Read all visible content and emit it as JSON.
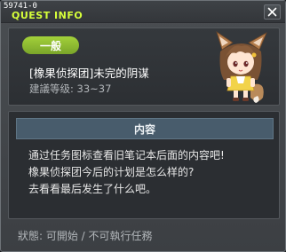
{
  "window": {
    "id": "59741-0",
    "title": "QUEST INFO"
  },
  "quest": {
    "category": "一般",
    "name": "[橡果侦探团]未完的阴谋",
    "level": "建議等级: 33~37"
  },
  "content": {
    "header": "内容",
    "lines": [
      "通过任务图标查看旧笔记本后面的内容吧!",
      "橡果侦探团今后的计划是怎么样的?",
      "去看看最后发生了什么吧。"
    ]
  },
  "status": "狀態: 可開始 / 不可執行任務",
  "colors": {
    "title": "#d6ff3a",
    "badge": "#8cbb2e",
    "header_bar": "#485c6c"
  },
  "icons": {
    "close": "close-icon",
    "npc": "npc-portrait"
  }
}
